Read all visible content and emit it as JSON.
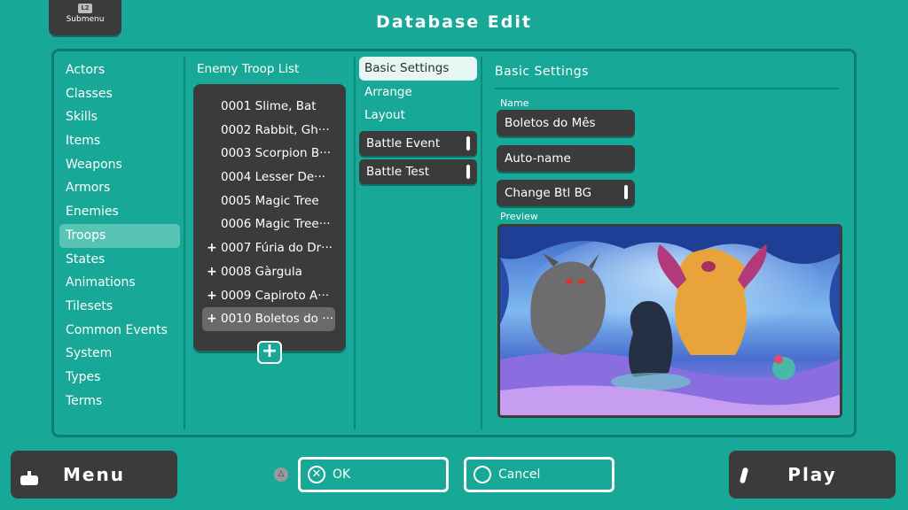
{
  "header": {
    "submenu_badge": "L2",
    "submenu_label": "Submenu",
    "title": "Database Edit"
  },
  "categories": [
    {
      "label": "Actors"
    },
    {
      "label": "Classes"
    },
    {
      "label": "Skills"
    },
    {
      "label": "Items"
    },
    {
      "label": "Weapons"
    },
    {
      "label": "Armors"
    },
    {
      "label": "Enemies"
    },
    {
      "label": "Troops"
    },
    {
      "label": "States"
    },
    {
      "label": "Animations"
    },
    {
      "label": "Tilesets"
    },
    {
      "label": "Common Events"
    },
    {
      "label": "System"
    },
    {
      "label": "Types"
    },
    {
      "label": "Terms"
    }
  ],
  "active_category": "Troops",
  "troop_list": {
    "heading": "Enemy Troop List",
    "items": [
      {
        "label": "0001 Slime, Bat",
        "plus": ""
      },
      {
        "label": "0002 Rabbit, Gh···",
        "plus": ""
      },
      {
        "label": "0003 Scorpion B···",
        "plus": ""
      },
      {
        "label": "0004 Lesser De···",
        "plus": ""
      },
      {
        "label": "0005 Magic Tree",
        "plus": ""
      },
      {
        "label": "0006 Magic Tree···",
        "plus": ""
      },
      {
        "label": "0007 Fúria do Dr···",
        "plus": "+"
      },
      {
        "label": "0008 Gàrgula",
        "plus": "+"
      },
      {
        "label": "0009 Capiroto A···",
        "plus": "+"
      },
      {
        "label": "0010 Boletos do ···",
        "plus": "+"
      }
    ],
    "add_label": "+"
  },
  "tabs": {
    "basic_settings": "Basic Settings",
    "arrange": "Arrange",
    "layout": "Layout",
    "battle_event": "Battle Event",
    "battle_test": "Battle Test"
  },
  "settings": {
    "heading": "Basic Settings",
    "name_label": "Name",
    "name_value": "Boletos do Mês",
    "auto_name": "Auto-name",
    "change_bg": "Change Btl BG",
    "preview_label": "Preview"
  },
  "footer": {
    "menu": "Menu",
    "triangle": "△",
    "ok": "OK",
    "ok_glyph": "✕",
    "cancel": "Cancel",
    "play": "Play"
  },
  "colors": {
    "background": "#17a898",
    "panel_border": "#0c7d70",
    "dark": "#3b3b3b",
    "highlight": "#58c4b6"
  }
}
